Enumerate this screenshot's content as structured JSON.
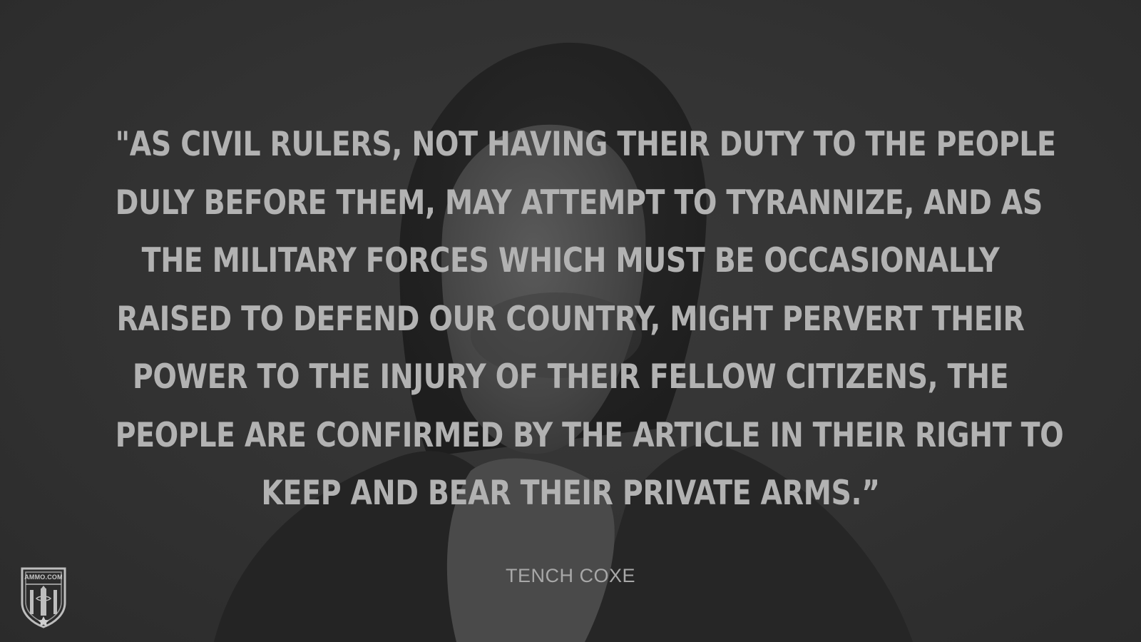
{
  "quote": {
    "lines": [
      "\"As civil rulers, not having their duty to the people",
      "duly before them, may attempt to tyrannize, and as",
      "the military forces which must be occasionally",
      "raised to defend our country, might pervert their",
      "power to the injury of their fellow citizens, the",
      "people are confirmed by the article in their right to",
      "keep and bear their private arms.”"
    ]
  },
  "author": "Tench Coxe",
  "logo": {
    "text": "AMMO.COM"
  },
  "colors": {
    "background": "#2e2e2e",
    "quote_text": "#b2b2b2",
    "author_text": "#a8a8a8"
  },
  "icons": {
    "logo": "shield-icon",
    "background_image": "portrait-engraving"
  }
}
